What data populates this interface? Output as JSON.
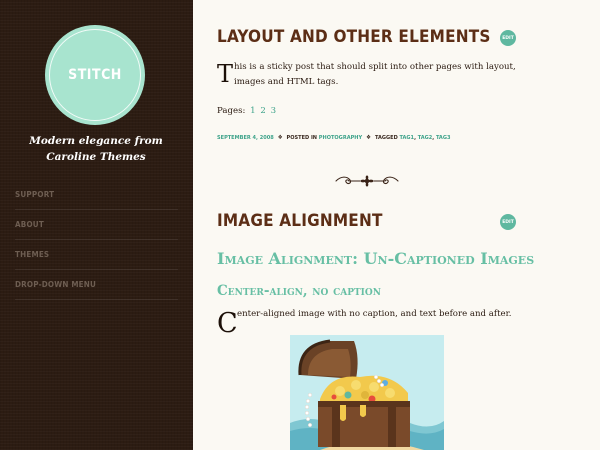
{
  "site": {
    "logo_text": "STITCH",
    "tagline": "Modern elegance from Caroline Themes"
  },
  "menu": {
    "items": [
      {
        "label": "SUPPORT"
      },
      {
        "label": "ABOUT"
      },
      {
        "label": "THEMES"
      },
      {
        "label": "DROP-DOWN MENU"
      }
    ]
  },
  "post1": {
    "title": "LAYOUT AND OTHER ELEMENTS",
    "edit_label": "EDIT",
    "dropcap": "T",
    "text": "his is a sticky post that should split into other pages with layout, images and HTML tags.",
    "pages_label": "Pages:",
    "pages": [
      "1",
      "2",
      "3"
    ],
    "meta": {
      "date": "SEPTEMBER 4, 2008",
      "posted_in": "POSTED IN",
      "category": "PHOTOGRAPHY",
      "tagged": "TAGGED",
      "tags": [
        "TAG1",
        "TAG2",
        "TAG3"
      ]
    }
  },
  "post2": {
    "title": "IMAGE ALIGNMENT",
    "edit_label": "EDIT",
    "subtitle": "Image Alignment: Un-Captioned Images",
    "subheading": "Center-align, no caption",
    "dropcap": "C",
    "text": "enter-aligned image with no caption, and text before and after."
  },
  "colors": {
    "sidebar_bg": "#2c1c12",
    "accent": "#5fb8a0",
    "title": "#5c2e16",
    "logo": "#a8e4cf"
  }
}
